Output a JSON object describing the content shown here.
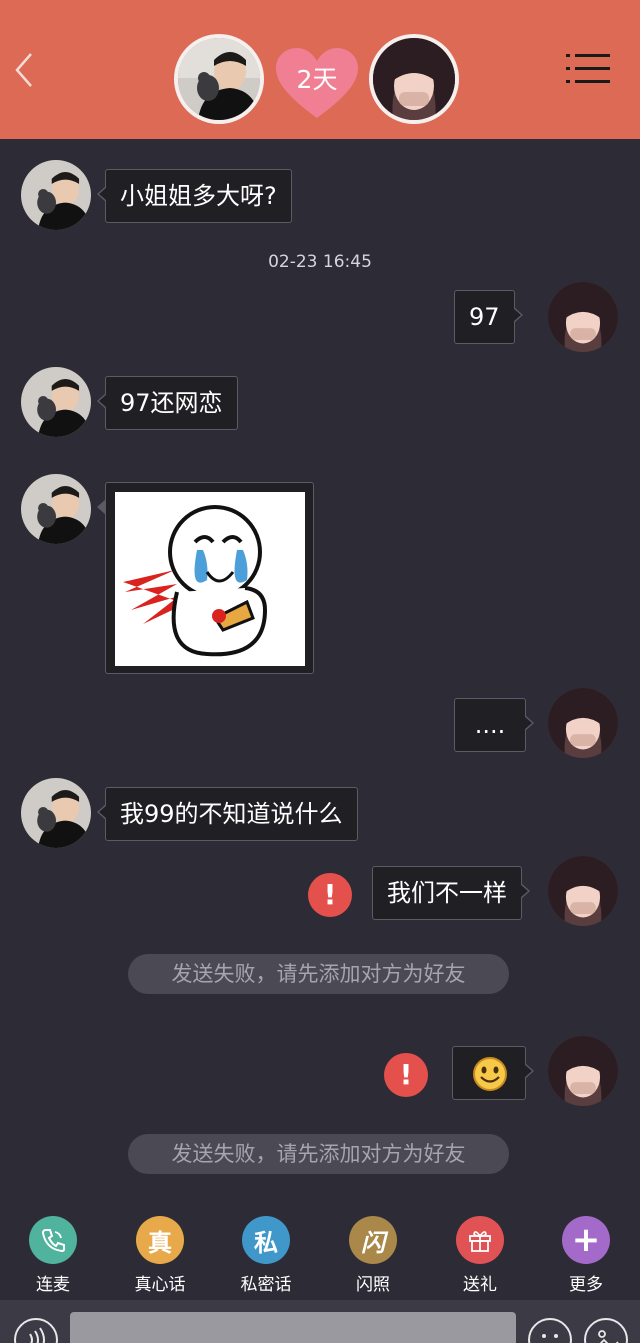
{
  "header": {
    "days_label": "2天",
    "colors": {
      "bar": "#dd6a55",
      "heart": "#f07f93"
    }
  },
  "messages": {
    "m1": "小姐姐多大呀?",
    "timestamp": "02-23 16:45",
    "m2": "97",
    "m3": "97还网恋",
    "m4": "....",
    "m5": "我99的不知道说什么",
    "m6": "我们不一样",
    "notice1": "发送失败，请先添加对方为好友",
    "notice2": "发送失败，请先添加对方为好友",
    "error_mark": "!"
  },
  "actions": [
    {
      "label": "连麦",
      "glyph": "",
      "icon": "phone-icon",
      "color": "#4fb39e"
    },
    {
      "label": "真心话",
      "glyph": "真",
      "icon": "truth-icon",
      "color": "#e8a94a"
    },
    {
      "label": "私密话",
      "glyph": "私",
      "icon": "private-icon",
      "color": "#3f98c9"
    },
    {
      "label": "闪照",
      "glyph": "闪",
      "icon": "flash-photo-icon",
      "color": "#a98849"
    },
    {
      "label": "送礼",
      "glyph": "",
      "icon": "gift-icon",
      "color": "#e15255"
    },
    {
      "label": "更多",
      "glyph": "+",
      "icon": "plus-icon",
      "color": "#a46ac9"
    }
  ],
  "input": {
    "placeholder": ""
  }
}
